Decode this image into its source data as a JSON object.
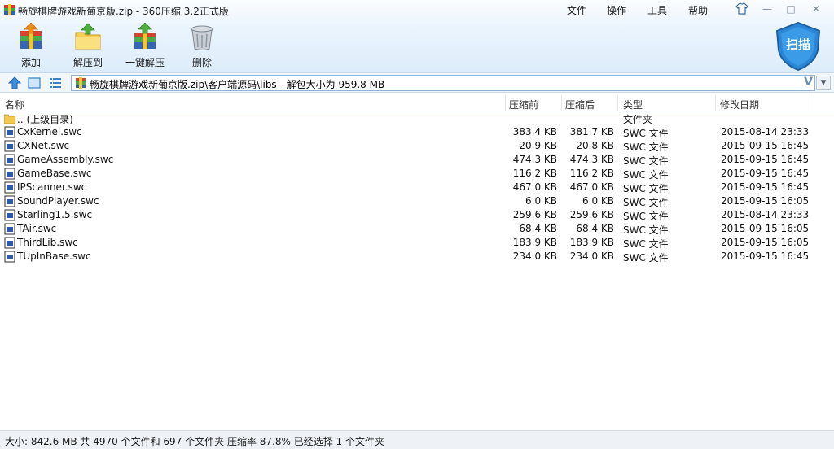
{
  "window": {
    "title": "畅旋棋牌游戏新葡京版.zip - 360压缩 3.2正式版",
    "menu": [
      "文件",
      "操作",
      "工具",
      "帮助"
    ],
    "controls": [
      "—",
      "□",
      "✕"
    ]
  },
  "toolbar": {
    "add_label": "添加",
    "extract_to_label": "解压到",
    "one_click_label": "一键解压",
    "delete_label": "删除",
    "scan_label": "扫描"
  },
  "address": {
    "path": "畅旋棋牌游戏新葡京版.zip\\客户端源码\\libs - 解包大小为 959.8 MB",
    "v_label": "V"
  },
  "columns": {
    "name": "名称",
    "packed": "压缩前",
    "unpacked": "压缩后",
    "type": "类型",
    "modified": "修改日期"
  },
  "rows": [
    {
      "name": ".. (上级目录)",
      "packed": "",
      "unpacked": "",
      "type": "文件夹",
      "modified": "",
      "icon": "folder-icon"
    },
    {
      "name": "CxKernel.swc",
      "packed": "383.4 KB",
      "unpacked": "381.7 KB",
      "type": "SWC 文件",
      "modified": "2015-08-14 23:33",
      "icon": "swc-file-icon"
    },
    {
      "name": "CXNet.swc",
      "packed": "20.9 KB",
      "unpacked": "20.8 KB",
      "type": "SWC 文件",
      "modified": "2015-09-15 16:45",
      "icon": "swc-file-icon"
    },
    {
      "name": "GameAssembly.swc",
      "packed": "474.3 KB",
      "unpacked": "474.3 KB",
      "type": "SWC 文件",
      "modified": "2015-09-15 16:45",
      "icon": "swc-file-icon"
    },
    {
      "name": "GameBase.swc",
      "packed": "116.2 KB",
      "unpacked": "116.2 KB",
      "type": "SWC 文件",
      "modified": "2015-09-15 16:45",
      "icon": "swc-file-icon"
    },
    {
      "name": "IPScanner.swc",
      "packed": "467.0 KB",
      "unpacked": "467.0 KB",
      "type": "SWC 文件",
      "modified": "2015-09-15 16:45",
      "icon": "swc-file-icon"
    },
    {
      "name": "SoundPlayer.swc",
      "packed": "6.0 KB",
      "unpacked": "6.0 KB",
      "type": "SWC 文件",
      "modified": "2015-09-15 16:05",
      "icon": "swc-file-icon"
    },
    {
      "name": "Starling1.5.swc",
      "packed": "259.6 KB",
      "unpacked": "259.6 KB",
      "type": "SWC 文件",
      "modified": "2015-08-14 23:33",
      "icon": "swc-file-icon"
    },
    {
      "name": "TAir.swc",
      "packed": "68.4 KB",
      "unpacked": "68.4 KB",
      "type": "SWC 文件",
      "modified": "2015-09-15 16:05",
      "icon": "swc-file-icon"
    },
    {
      "name": "ThirdLib.swc",
      "packed": "183.9 KB",
      "unpacked": "183.9 KB",
      "type": "SWC 文件",
      "modified": "2015-09-15 16:05",
      "icon": "swc-file-icon"
    },
    {
      "name": "TUpInBase.swc",
      "packed": "234.0 KB",
      "unpacked": "234.0 KB",
      "type": "SWC 文件",
      "modified": "2015-09-15 16:45",
      "icon": "swc-file-icon"
    }
  ],
  "status": {
    "text": "大小: 842.6 MB 共 4970 个文件和 697 个文件夹 压缩率 87.8% 已经选择 1 个文件夹"
  },
  "colors": {
    "header_gradient_top": "#fbfdff",
    "header_gradient_bottom": "#dcecfa",
    "shield_blue": "#2a86d6"
  }
}
